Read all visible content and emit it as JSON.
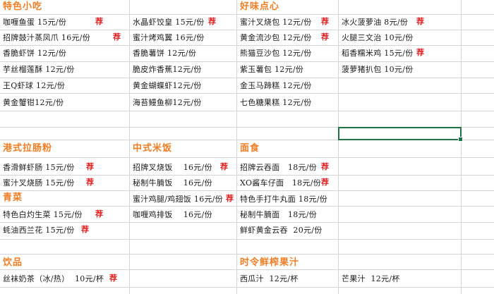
{
  "rec_mark": "荐",
  "colors": {
    "header": "#f07d23",
    "recommend": "#e02020",
    "selection": "#217346"
  },
  "sections": [
    {
      "key": "snacks",
      "title": "特色小吃"
    },
    {
      "key": "dimsum",
      "title": "好味点心"
    },
    {
      "key": "hk_rice_roll",
      "title": "港式拉肠粉"
    },
    {
      "key": "chinese_rice",
      "title": "中式米饭"
    },
    {
      "key": "noodles",
      "title": "面食"
    },
    {
      "key": "vegetables",
      "title": "青菜"
    },
    {
      "key": "drinks",
      "title": "饮品"
    },
    {
      "key": "juice",
      "title": "时令鲜榨果汁"
    }
  ],
  "items": [
    {
      "name": "咖喱鱼蛋",
      "price": "15元/份",
      "rec": true
    },
    {
      "name": "招牌鼓汁蒸凤爪",
      "price": "16元/份",
      "rec": true
    },
    {
      "name": "香脆虾饼",
      "price": "12元/份",
      "rec": false
    },
    {
      "name": "芋丝榴莲酥",
      "price": "12元/份",
      "rec": false
    },
    {
      "name": "王Q虾球",
      "price": "12元/份",
      "rec": false
    },
    {
      "name": "黄金蟹钳12元/份",
      "price": "",
      "rec": false
    },
    {
      "name": "水晶虾饺皇",
      "price": "15元/份",
      "rec": true
    },
    {
      "name": "蜜汁烤鸡翼",
      "price": "16元/份",
      "rec": false
    },
    {
      "name": "香脆薯饼",
      "price": "12元/份",
      "rec": false
    },
    {
      "name": "脆皮炸香蕉12元/份",
      "price": "",
      "rec": false
    },
    {
      "name": "黄金蝴蝶虾12元/份",
      "price": "",
      "rec": false
    },
    {
      "name": "海苔鳗鱼柳12元/份",
      "price": "",
      "rec": false
    },
    {
      "name": "蜜汁叉烧包",
      "price": "12元/份",
      "rec": true
    },
    {
      "name": "黄金流沙包",
      "price": "12元/份",
      "rec": true
    },
    {
      "name": "熊猫豆沙包",
      "price": "12元/份",
      "rec": false
    },
    {
      "name": "紫玉薯包",
      "price": "12元/份",
      "rec": false
    },
    {
      "name": "金玉马蹄糕",
      "price": "12元/份",
      "rec": false
    },
    {
      "name": "七色糖果糕",
      "price": "12元/份",
      "rec": false
    },
    {
      "name": "冰火菠萝油",
      "price": "8元/份",
      "rec": true
    },
    {
      "name": "火腿三文治",
      "price": "10元/份",
      "rec": false
    },
    {
      "name": "稻香糯米鸡",
      "price": "15元/份",
      "rec": true
    },
    {
      "name": "菠萝猪扒包",
      "price": "10元/份",
      "rec": false
    },
    {
      "name": "香滑鲜虾肠",
      "price": "15元/份",
      "rec": true
    },
    {
      "name": "蜜汁叉烧肠",
      "price": "15元/份",
      "rec": true
    },
    {
      "name": "特色白灼生菜",
      "price": "15元/份",
      "rec": true
    },
    {
      "name": "蚝油西兰花",
      "price": "15元/份",
      "rec": true
    },
    {
      "name": "招牌叉烧饭",
      "price": "16元/份",
      "rec": true
    },
    {
      "name": "秘制牛腩饭",
      "price": "16元/份",
      "rec": false
    },
    {
      "name": "蜜汁鸡腿/鸡翅饭",
      "price": "16元/份",
      "rec": true
    },
    {
      "name": "咖喱鸡排饭",
      "price": "16元/份",
      "rec": false
    },
    {
      "name": "招牌云吞面",
      "price": "18元/份",
      "rec": true
    },
    {
      "name": "XO酱车仔面",
      "price": "18元/份",
      "rec": true
    },
    {
      "name": "特色手打牛丸面",
      "price": "18元/份",
      "rec": false
    },
    {
      "name": "秘制牛腩面",
      "price": "18元/份",
      "rec": false
    },
    {
      "name": "鲜虾黄金云吞",
      "price": "20元/份",
      "rec": false
    },
    {
      "name": "丝袜奶茶（冰/热）",
      "price": "10元/杯",
      "rec": true
    },
    {
      "name": "西瓜汁",
      "price": "12元/杯",
      "rec": false
    },
    {
      "name": "芒果汁",
      "price": "12元/杯",
      "rec": false
    }
  ]
}
